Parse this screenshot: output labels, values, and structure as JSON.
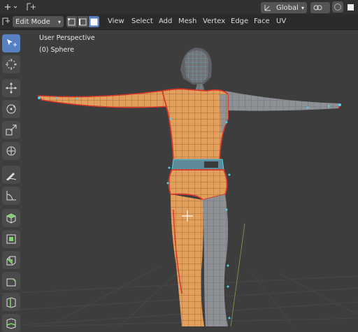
{
  "header": {
    "mode": "Edit Mode",
    "menus": [
      "View",
      "Select",
      "Add",
      "Mesh",
      "Vertex",
      "Edge",
      "Face",
      "UV"
    ]
  },
  "topbar": {
    "orientation": "Global"
  },
  "viewport": {
    "perspective_label": "User Perspective",
    "object_label": "(0) Sphere"
  },
  "colors": {
    "viewport_bg": "#3d3d3d",
    "selected_face": "#e8a25a",
    "seam": "#d9372a",
    "vertex": "#4fd6e6",
    "active_tool": "#5680c2"
  },
  "tools": [
    {
      "icon": "select-box-icon",
      "active": true
    },
    {
      "icon": "cursor-icon"
    },
    {
      "icon": "move-icon"
    },
    {
      "icon": "rotate-icon"
    },
    {
      "icon": "scale-icon"
    },
    {
      "icon": "transform-icon"
    },
    {
      "icon": "annotate-icon"
    },
    {
      "icon": "measure-icon"
    },
    {
      "icon": "add-cube-icon"
    },
    {
      "icon": "extrude-icon"
    },
    {
      "icon": "inset-icon"
    },
    {
      "icon": "bevel-icon"
    },
    {
      "icon": "loop-cut-icon"
    },
    {
      "icon": "knife-icon"
    }
  ]
}
